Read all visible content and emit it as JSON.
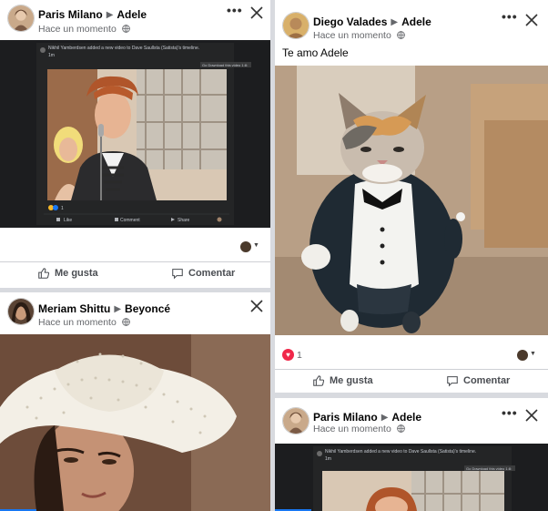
{
  "left": {
    "post1": {
      "author": "Paris Milano",
      "target": "Adele",
      "timestamp": "Hace un momento",
      "embed_header": "Nikhil Yamberdsen added a new video to Dave Saullsta (Satista)'s timeline.",
      "embed_time": "1m",
      "embed_tag": "Go Download this video 1:8:",
      "embed_count": "1",
      "embed_like": "Like",
      "embed_comment": "Comment",
      "embed_share": "Share",
      "like_label": "Me gusta",
      "comment_label": "Comentar"
    },
    "post2": {
      "author": "Meriam Shittu",
      "target": "Beyoncé",
      "timestamp": "Hace un momento"
    }
  },
  "right": {
    "post1": {
      "author": "Diego Valades",
      "target": "Adele",
      "timestamp": "Hace un momento",
      "text": "Te amo Adele",
      "reaction_count": "1",
      "like_label": "Me gusta",
      "comment_label": "Comentar"
    },
    "post2": {
      "author": "Paris Milano",
      "target": "Adele",
      "timestamp": "Hace un momento",
      "embed_header": "Nikhil Yamberdsen added a new video to Dave Saullsta (Satista)'s timeline.",
      "embed_time": "1m",
      "embed_tag": "Go Download this video 1:8:"
    }
  },
  "icons": {
    "menu": "more-dots-icon",
    "close": "close-icon",
    "privacy": "globe-icon",
    "like": "thumbs-up-icon",
    "comment": "comment-bubble-icon",
    "reaction": "heart-icon"
  },
  "colors": {
    "heart": "#f0284a",
    "fb_blue": "#1877f2",
    "secondary_text": "#65676b"
  }
}
